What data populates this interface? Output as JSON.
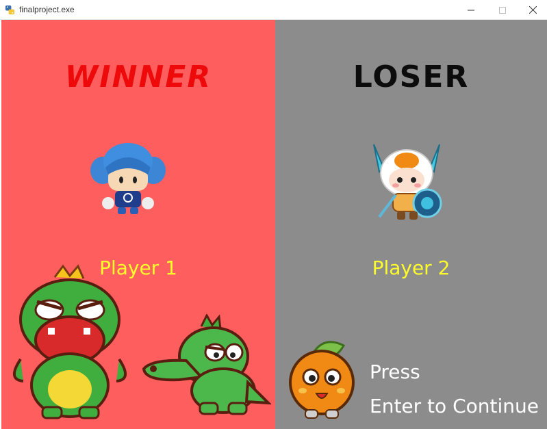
{
  "window": {
    "title": "finalproject.exe",
    "icon": "python-icon",
    "controls": [
      "minimize-icon",
      "maximize-icon",
      "close-icon"
    ]
  },
  "winner_panel": {
    "heading": "WINNER",
    "player": "Player 1",
    "background_color": "#fe5e5e",
    "heading_color": "#ee0a0a",
    "player_color": "#fcfc2c"
  },
  "loser_panel": {
    "heading": "LOSER",
    "player": "Player 2",
    "background_color": "#8c8c8c",
    "heading_color": "#0c0c0c",
    "player_color": "#fcfc2c"
  },
  "prompt": {
    "line1": "Press",
    "line2": "Enter to Continue",
    "color": "#ffffff"
  }
}
